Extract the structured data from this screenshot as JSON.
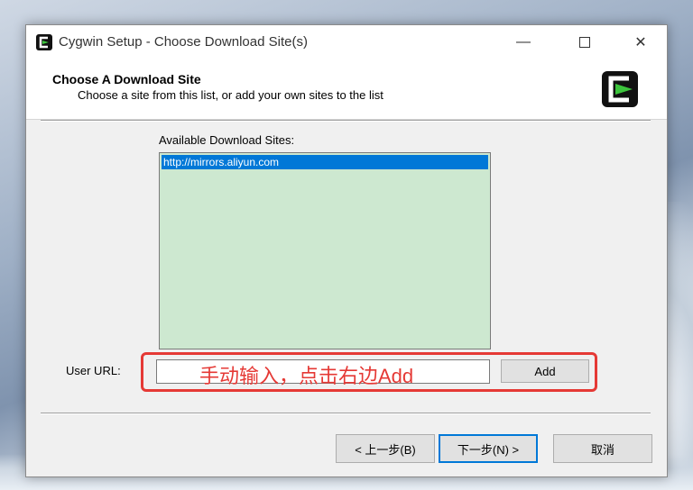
{
  "window": {
    "title": "Cygwin Setup - Choose Download Site(s)",
    "minimize_glyph": "—",
    "close_glyph": "✕"
  },
  "header": {
    "title": "Choose A Download Site",
    "subtitle": "Choose a site from this list, or add your own sites to the list"
  },
  "sites": {
    "label": "Available Download Sites:",
    "items": [
      "http://mirrors.aliyun.com"
    ]
  },
  "user_url": {
    "label": "User URL:",
    "value": "",
    "add_label": "Add"
  },
  "annotation": {
    "text": "手动输入，点击右边Add",
    "color": "#e53935"
  },
  "footer": {
    "back_label": "< 上一步(B)",
    "next_label": "下一步(N) >",
    "cancel_label": "取消"
  },
  "colors": {
    "selection": "#0078d7",
    "list_background": "#cde8d0",
    "logo_accent": "#3cc43c"
  },
  "icons": {
    "app": "cygwin-logo-icon",
    "minimize": "minimize-icon",
    "maximize": "maximize-icon",
    "close": "close-icon"
  }
}
